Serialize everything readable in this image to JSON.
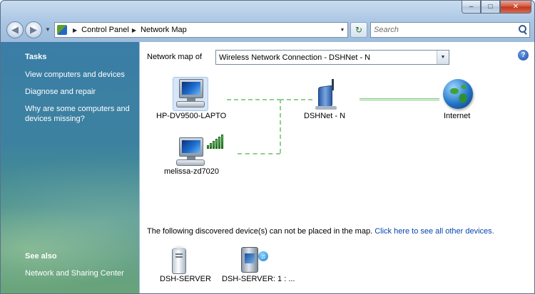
{
  "window": {
    "controls": {
      "minimize": "–",
      "maximize": "□",
      "close": "✕"
    }
  },
  "navigation": {
    "back_icon": "back-arrow-icon",
    "forward_icon": "forward-arrow-icon",
    "breadcrumb": [
      "Control Panel",
      "Network Map"
    ],
    "search_placeholder": "Search"
  },
  "sidebar": {
    "tasks_heading": "Tasks",
    "tasks": [
      "View computers and devices",
      "Diagnose and repair",
      "Why are some computers and devices missing?"
    ],
    "see_also_heading": "See also",
    "see_also": [
      "Network and Sharing Center"
    ]
  },
  "main": {
    "network_map_label": "Network map of",
    "selected_connection": "Wireless Network Connection - DSHNet - N",
    "help_label": "?",
    "devices": {
      "laptop": "HP-DV9500-LAPTO",
      "router": "DSHNet - N",
      "internet": "Internet",
      "wireless_pc": "melissa-zd7020"
    },
    "discovered_text": "The following discovered device(s) can not be placed in the map.",
    "discovered_link": "Click here to see all other devices.",
    "unplaced_devices": [
      "DSH-SERVER",
      "DSH-SERVER: 1 : ..."
    ]
  },
  "colors": {
    "sidebar_top": "#3b7da6",
    "sidebar_bottom": "#6aa47a",
    "link": "#0645ad",
    "connection_line": "#8fcf8f"
  }
}
